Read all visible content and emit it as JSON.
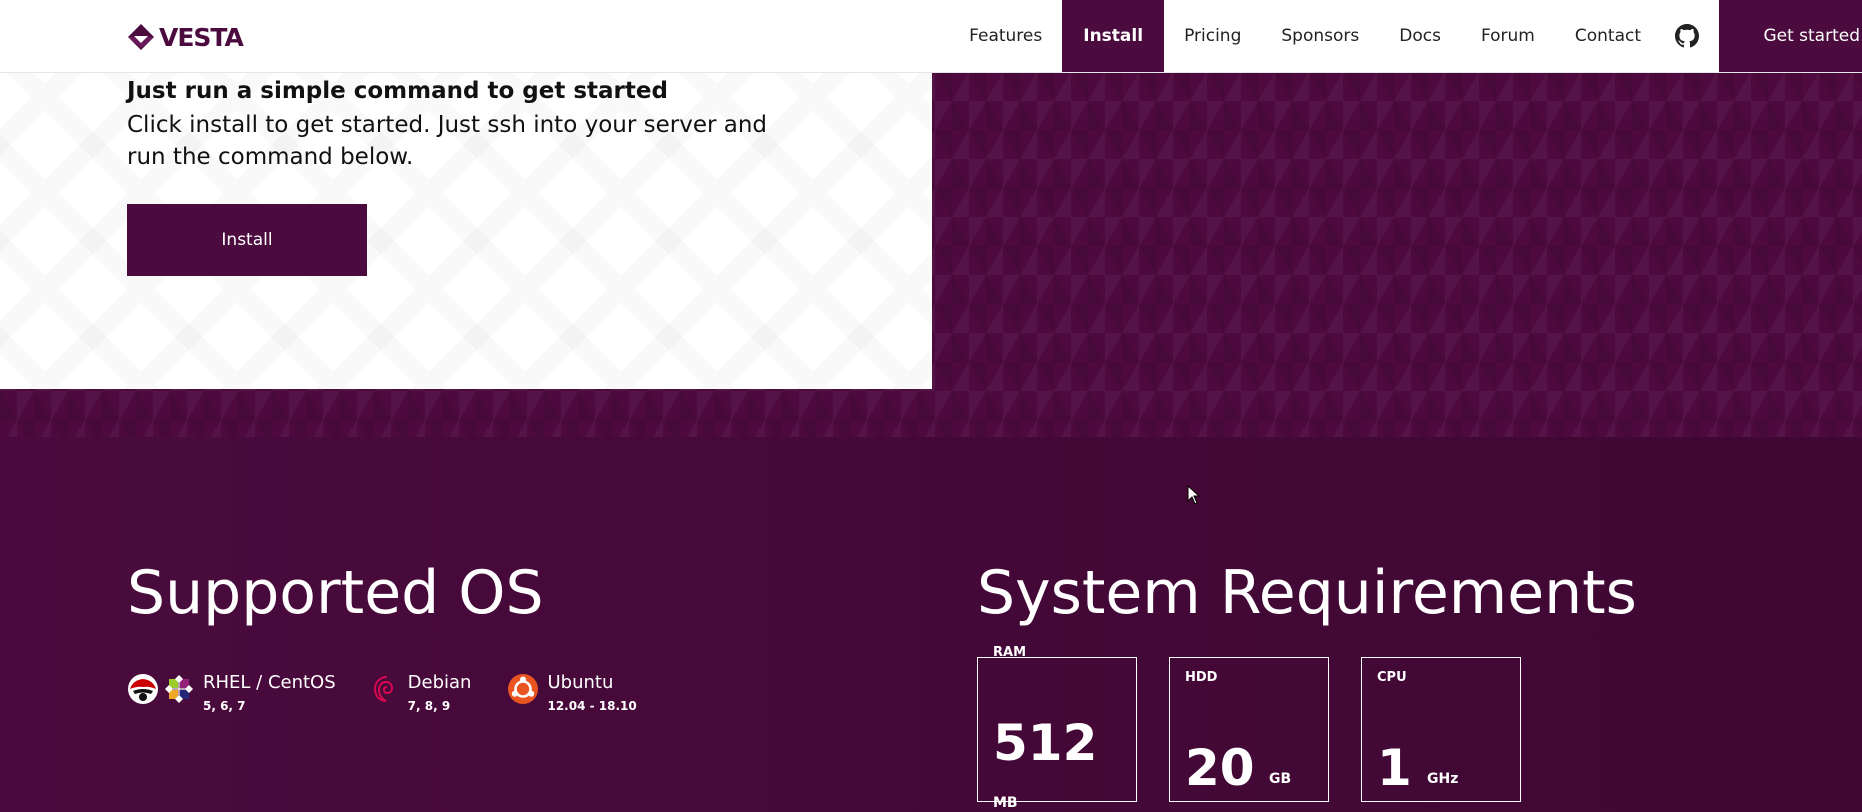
{
  "header": {
    "logo_text": "VESTA",
    "nav": [
      {
        "label": "Features"
      },
      {
        "label": "Install",
        "active": true
      },
      {
        "label": "Pricing"
      },
      {
        "label": "Sponsors"
      },
      {
        "label": "Docs"
      },
      {
        "label": "Forum"
      },
      {
        "label": "Contact"
      }
    ],
    "github_icon": "github-icon",
    "cta_label": "Get started"
  },
  "hero": {
    "title": "Just run a simple command to get started",
    "description": "Click install to get started. Just ssh into your server and run the command below.",
    "install_label": "Install"
  },
  "os": {
    "heading": "Supported OS",
    "items": [
      {
        "name": "RHEL / CentOS",
        "versions": "5, 6, 7",
        "icons": [
          "redhat-icon",
          "centos-icon"
        ]
      },
      {
        "name": "Debian",
        "versions": "7, 8, 9",
        "icons": [
          "debian-icon"
        ]
      },
      {
        "name": "Ubuntu",
        "versions": "12.04 - 18.10",
        "icons": [
          "ubuntu-icon"
        ]
      }
    ]
  },
  "requirements": {
    "heading": "System Requirements",
    "items": [
      {
        "label": "RAM",
        "value": "512",
        "unit": "MB"
      },
      {
        "label": "HDD",
        "value": "20",
        "unit": "GB"
      },
      {
        "label": "CPU",
        "value": "1",
        "unit": "GHz"
      }
    ]
  },
  "colors": {
    "brand": "#4b0b3f",
    "text_dark": "#111111",
    "on_brand": "#ffffff"
  }
}
